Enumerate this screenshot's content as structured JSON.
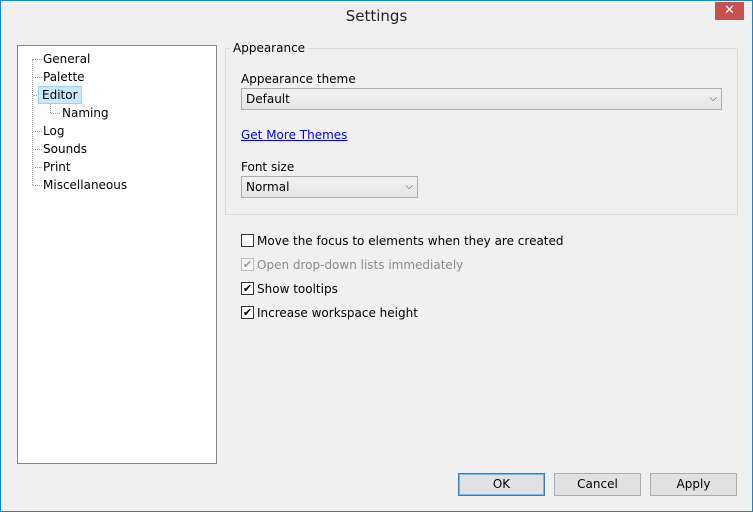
{
  "window": {
    "title": "Settings",
    "close_label": "✕"
  },
  "tree": {
    "items": [
      {
        "label": "General"
      },
      {
        "label": "Palette"
      },
      {
        "label": "Editor"
      },
      {
        "label": "Naming"
      },
      {
        "label": "Log"
      },
      {
        "label": "Sounds"
      },
      {
        "label": "Print"
      },
      {
        "label": "Miscellaneous"
      }
    ],
    "selected": "Editor"
  },
  "appearance": {
    "group_title": "Appearance",
    "theme_label": "Appearance theme",
    "theme_value": "Default",
    "more_themes_link": "Get More Themes",
    "font_size_label": "Font size",
    "font_size_value": "Normal"
  },
  "options": [
    {
      "label": "Move the focus to elements when they are created",
      "checked": false,
      "enabled": true
    },
    {
      "label": "Open drop-down lists immediately",
      "checked": true,
      "enabled": false
    },
    {
      "label": "Show tooltips",
      "checked": true,
      "enabled": true
    },
    {
      "label": "Increase workspace height",
      "checked": true,
      "enabled": true
    }
  ],
  "buttons": {
    "ok": "OK",
    "cancel": "Cancel",
    "apply": "Apply"
  }
}
